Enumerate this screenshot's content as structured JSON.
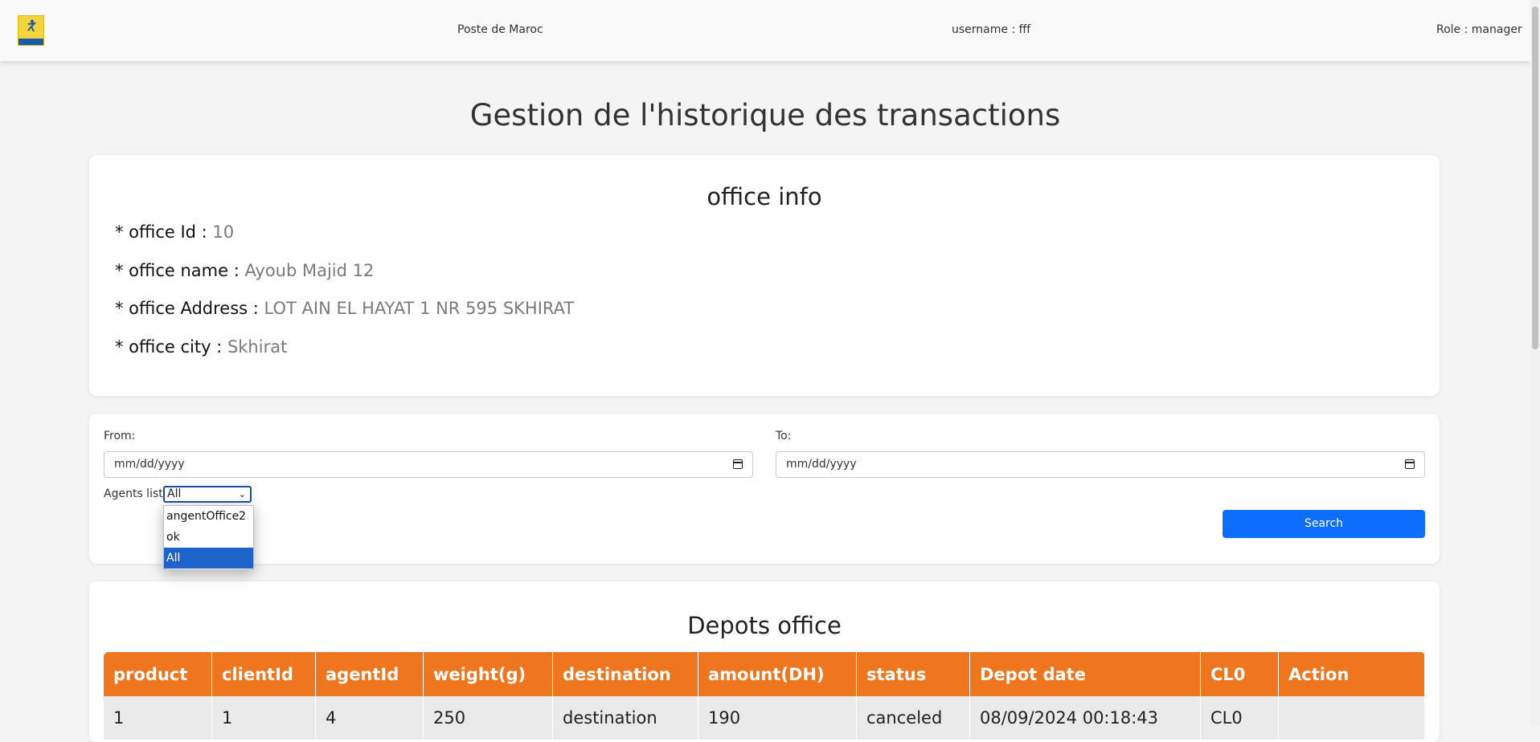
{
  "navbar": {
    "brand": "Poste de Maroc",
    "username": "username : fff",
    "role": "Role : manager",
    "logo_icon": "poste-maroc-logo"
  },
  "page_title": "Gestion de l'historique des transactions",
  "office": {
    "title": "office info",
    "id_label": "* office Id : ",
    "id_value": "10",
    "name_label": "* office name : ",
    "name_value": "Ayoub Majid 12",
    "address_label": "* office Address : ",
    "address_value": "LOT AIN EL HAYAT 1 NR 595 SKHIRAT",
    "city_label": "* office city : ",
    "city_value": "Skhirat"
  },
  "filters": {
    "from_label": "From:",
    "from_placeholder": "mm/dd/yyyy",
    "to_label": "To:",
    "to_placeholder": "mm/dd/yyyy",
    "agents_label": "Agents list:",
    "agents_selected": "All",
    "agents_options": [
      "angentOffice2",
      "ok",
      "All"
    ],
    "search_label": "Search"
  },
  "table": {
    "title": "Depots office",
    "headers": [
      "product",
      "clientId",
      "agentId",
      "weight(g)",
      "destination",
      "amount(DH)",
      "status",
      "Depot date",
      "CL0",
      "Action"
    ],
    "rows": [
      [
        "1",
        "1",
        "4",
        "250",
        "destination",
        "190",
        "canceled",
        "08/09/2024 00:18:43",
        "CL0",
        ""
      ]
    ]
  },
  "colors": {
    "header_orange": "#ee761f",
    "primary_blue": "#0d6efd",
    "selected_option": "#1e63c9"
  }
}
